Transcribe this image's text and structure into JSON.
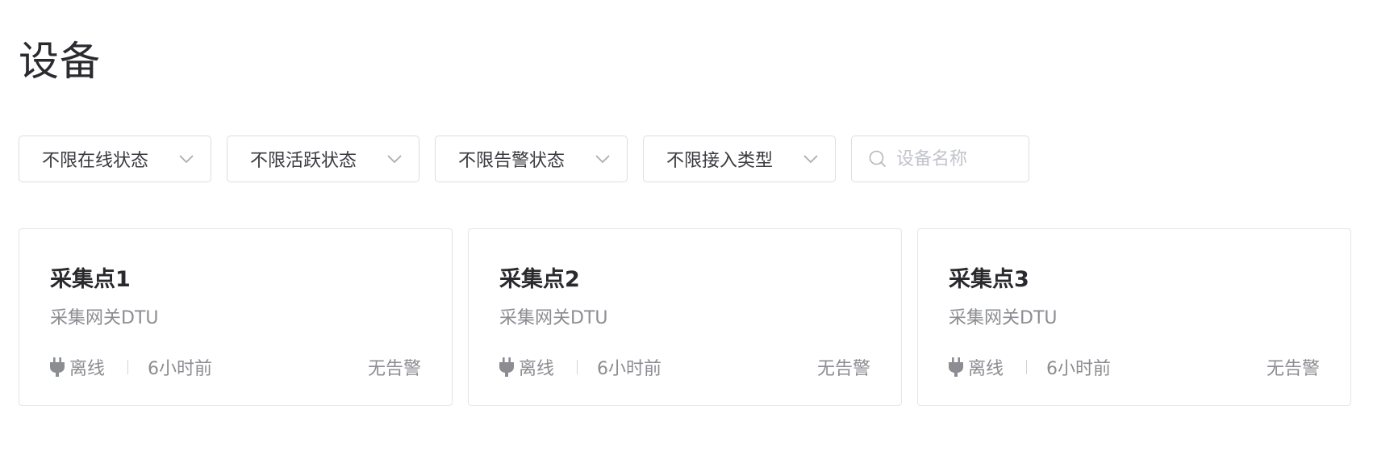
{
  "page": {
    "title": "设备"
  },
  "filters": [
    {
      "label": "不限在线状态",
      "icon": "chevron-down-icon"
    },
    {
      "label": "不限活跃状态",
      "icon": "chevron-down-icon"
    },
    {
      "label": "不限告警状态",
      "icon": "chevron-down-icon"
    },
    {
      "label": "不限接入类型",
      "icon": "chevron-down-icon"
    }
  ],
  "search": {
    "placeholder": "设备名称",
    "value": "",
    "icon": "search-icon"
  },
  "devices": [
    {
      "name": "采集点1",
      "type": "采集网关DTU",
      "status": "离线",
      "status_icon": "plug-icon",
      "last_active": "6小时前",
      "alarm": "无告警"
    },
    {
      "name": "采集点2",
      "type": "采集网关DTU",
      "status": "离线",
      "status_icon": "plug-icon",
      "last_active": "6小时前",
      "alarm": "无告警"
    },
    {
      "name": "采集点3",
      "type": "采集网关DTU",
      "status": "离线",
      "status_icon": "plug-icon",
      "last_active": "6小时前",
      "alarm": "无告警"
    }
  ],
  "colors": {
    "border": "#dcdde2",
    "muted_text": "#8c8d92",
    "placeholder": "#c2c4cb",
    "title_text": "#2b2b2f"
  }
}
